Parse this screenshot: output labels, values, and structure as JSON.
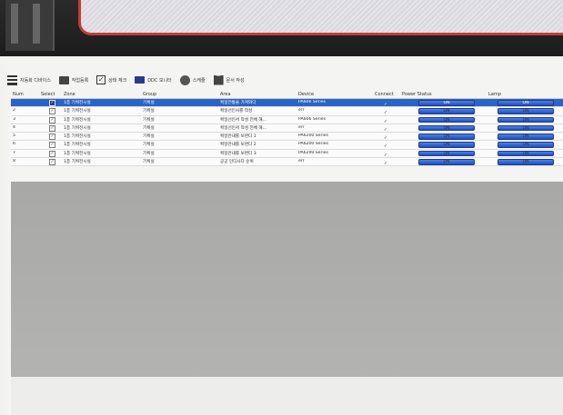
{
  "toolbar": {
    "items": [
      {
        "icon": "list-icon",
        "label": "자동화 디바이스"
      },
      {
        "icon": "folder-icon",
        "label": "작업등록"
      },
      {
        "icon": "checkbox-icon",
        "label": "상태 체크"
      },
      {
        "icon": "monitor-icon",
        "label": "DDC 모니터"
      },
      {
        "icon": "gear-icon",
        "label": "스케줄"
      },
      {
        "icon": "book-icon",
        "label": "문서 작성"
      }
    ]
  },
  "table": {
    "headers": [
      "Num",
      "Select",
      "Zone",
      "Group",
      "Area",
      "Device",
      "Connect",
      "Power Status",
      "Lamp"
    ],
    "rows": [
      {
        "num": "",
        "zone": "1층 기획전시실",
        "group": "기획실",
        "area": "획일전통을 가져와다",
        "device": "PA606 Series",
        "selected": true,
        "power": "ON",
        "lamp": "ON"
      },
      {
        "num": "2",
        "zone": "1층 기획전시실",
        "group": "기획실",
        "area": "획일선인사를 작성",
        "device": "err",
        "selected": false,
        "power": "ON",
        "lamp": "ON"
      },
      {
        "num": "3",
        "zone": "1층 기획전시실",
        "group": "기획실",
        "area": "획일선인서 작성 전체 해...",
        "device": "PA606 Series",
        "selected": false,
        "power": "ON",
        "lamp": "ON"
      },
      {
        "num": "4",
        "zone": "1층 기획전시실",
        "group": "기획실",
        "area": "획일선인서 작성 전체 해...",
        "device": "err",
        "selected": false,
        "power": "ON",
        "lamp": "ON"
      },
      {
        "num": "5",
        "zone": "1층 기획전시실",
        "group": "기획실",
        "area": "획일안내를 보완다 1",
        "device": "PA6200 Series",
        "selected": false,
        "power": "ON",
        "lamp": "ON"
      },
      {
        "num": "6",
        "zone": "1층 기획전시실",
        "group": "기획실",
        "area": "획일안내를 보완다 2",
        "device": "PA6200 Series",
        "selected": false,
        "power": "ON",
        "lamp": "ON"
      },
      {
        "num": "7",
        "zone": "1층 기획전시실",
        "group": "기획실",
        "area": "획일안내를 보완다 3",
        "device": "PA6200 Series",
        "selected": false,
        "power": "ON",
        "lamp": "ON"
      },
      {
        "num": "8",
        "zone": "1층 기획전시실",
        "group": "기획실",
        "area": "공공 인디사다 순위",
        "device": "err",
        "selected": false,
        "power": "ON",
        "lamp": "ON"
      }
    ]
  },
  "colors": {
    "selected_row": "#2b63c8",
    "on_button": "#1f4fbd",
    "connect_check": "#2e9a32",
    "frame_accent": "#c63a36"
  }
}
